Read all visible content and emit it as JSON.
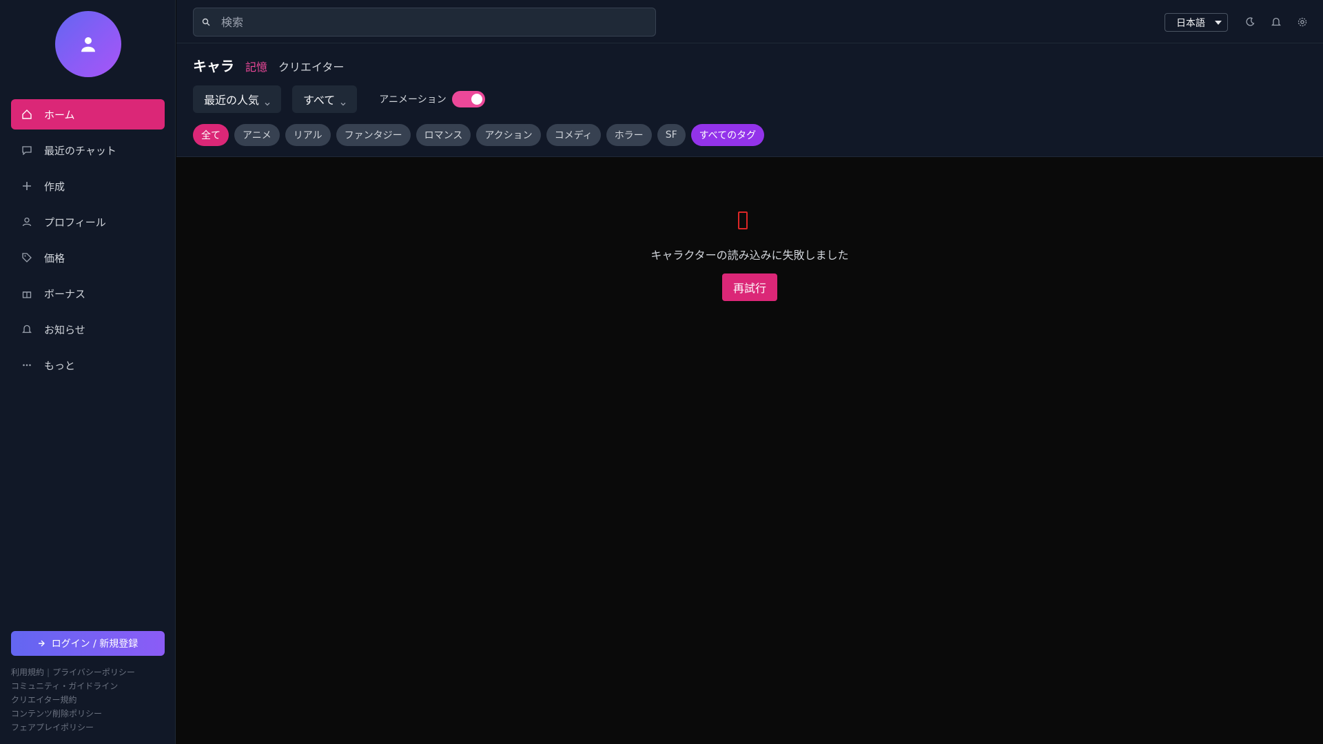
{
  "sidebar": {
    "logo_icon": "avatar-icon",
    "nav": [
      {
        "label": "ホーム",
        "icon": "home-icon",
        "active": true
      },
      {
        "label": "最近のチャット",
        "icon": "chat-icon"
      },
      {
        "label": "作成",
        "icon": "plus-icon"
      },
      {
        "label": "プロフィール",
        "icon": "user-icon"
      },
      {
        "label": "価格",
        "icon": "price-icon"
      },
      {
        "label": "ボーナス",
        "icon": "gift-icon"
      },
      {
        "label": "お知らせ",
        "icon": "bell-icon"
      },
      {
        "label": "もっと",
        "icon": "more-icon"
      }
    ],
    "login_label": "ログイン / 新規登録",
    "footer": {
      "terms": "利用規約",
      "separator": "|",
      "privacy": "プライバシーポリシー",
      "community": "コミュニティ・ガイドライン",
      "creator_terms": "クリエイター規約",
      "content_removal": "コンテンツ削除ポリシー",
      "fair_play": "フェアプレイポリシー"
    }
  },
  "header": {
    "search_placeholder": "検索",
    "language": "日本語",
    "title": "キャラ",
    "tabs": [
      "記憶",
      "クリエイター"
    ],
    "sort_label": "最近の人気",
    "filter_label": "すべて",
    "animation_label": "アニメーション",
    "animation_on": true,
    "tags": [
      "全て",
      "アニメ",
      "リアル",
      "ファンタジー",
      "ロマンス",
      "アクション",
      "コメディ",
      "ホラー",
      "SF",
      "すべてのタグ"
    ]
  },
  "main": {
    "error_icon": "error-icon",
    "error_message": "キャラクターの読み込みに失敗しました",
    "retry_label": "再試行"
  },
  "colors": {
    "accent": "#db2777",
    "purple": "#9333ea",
    "sidebar_bg": "#111827",
    "main_bg": "#0a0a0a"
  }
}
